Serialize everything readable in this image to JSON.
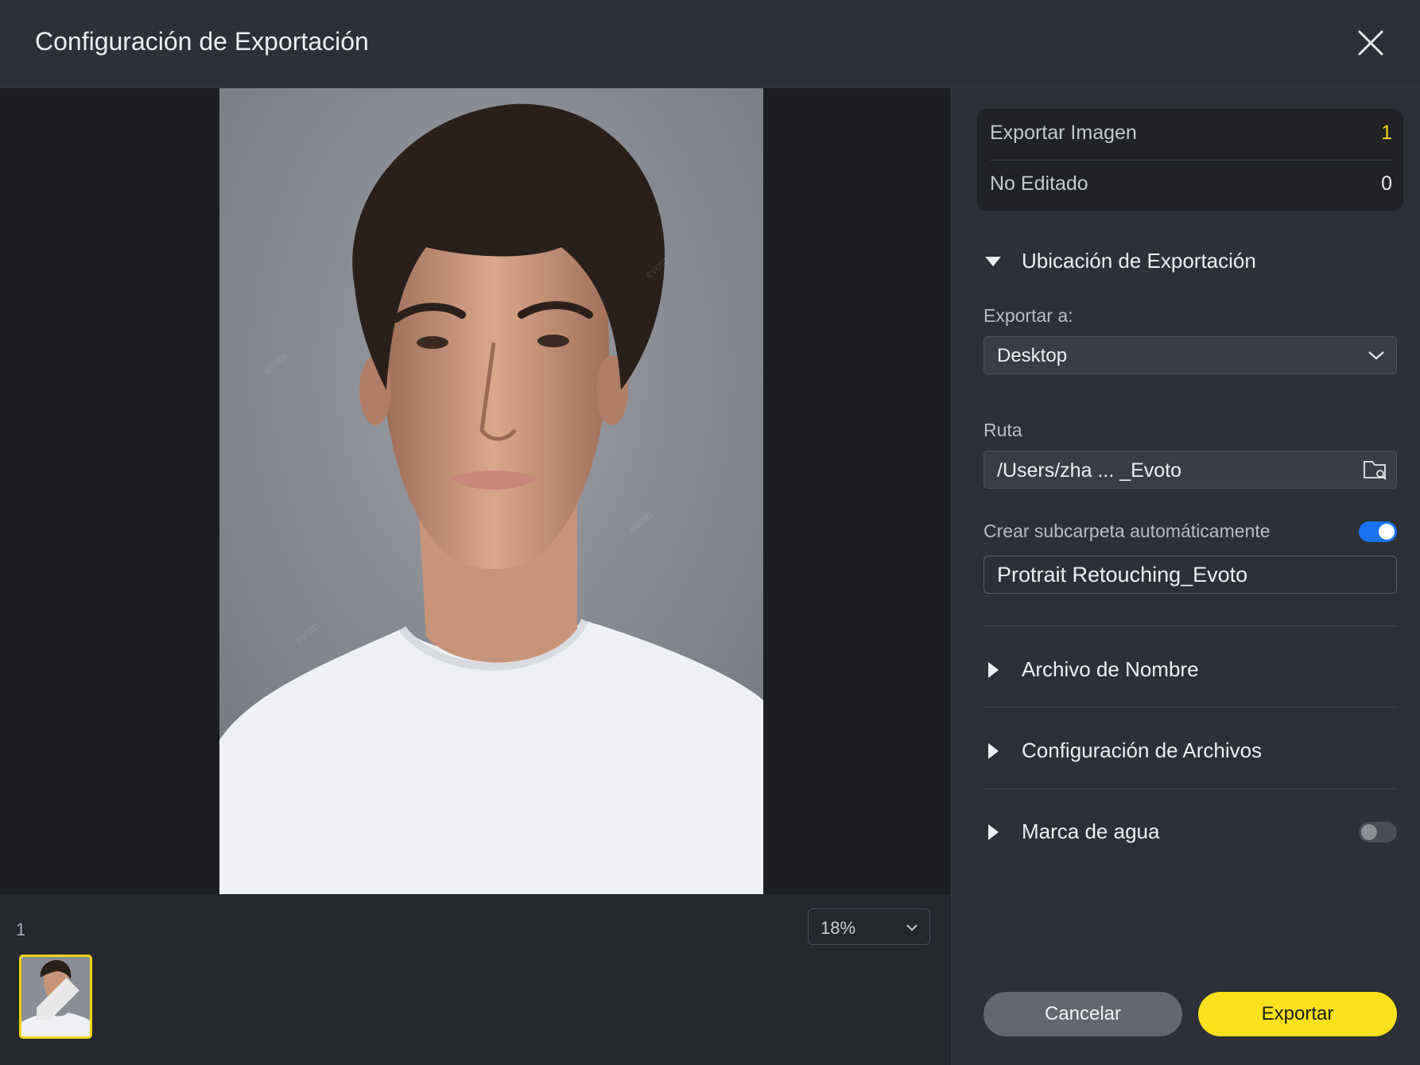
{
  "window": {
    "title": "Configuración de Exportación"
  },
  "colors": {
    "accent": "#fbe11c",
    "toggle_on": "#1a73f0",
    "toggle_off": "#4a4d53"
  },
  "summary": {
    "export_label": "Exportar Imagen",
    "export_count": "1",
    "unedited_label": "No Editado",
    "unedited_count": "0"
  },
  "location": {
    "section_title": "Ubicación de Exportación",
    "export_to_label": "Exportar a:",
    "export_to_value": "Desktop",
    "path_label": "Ruta",
    "path_value": "/Users/zha ... _Evoto",
    "subfolder_label": "Crear subcarpeta automáticamente",
    "subfolder_enabled": true,
    "subfolder_name": "Protrait Retouching_Evoto"
  },
  "sections": {
    "file_name": "Archivo de Nombre",
    "file_settings": "Configuración de Archivos",
    "watermark": "Marca de agua",
    "watermark_enabled": false
  },
  "preview": {
    "page_number": "1",
    "zoom": "18%"
  },
  "actions": {
    "cancel": "Cancelar",
    "export": "Exportar"
  },
  "icons": [
    "close-icon",
    "chevron-down-icon",
    "folder-search-icon",
    "triangle-down-icon",
    "triangle-right-icon",
    "edit-badge-icon"
  ]
}
